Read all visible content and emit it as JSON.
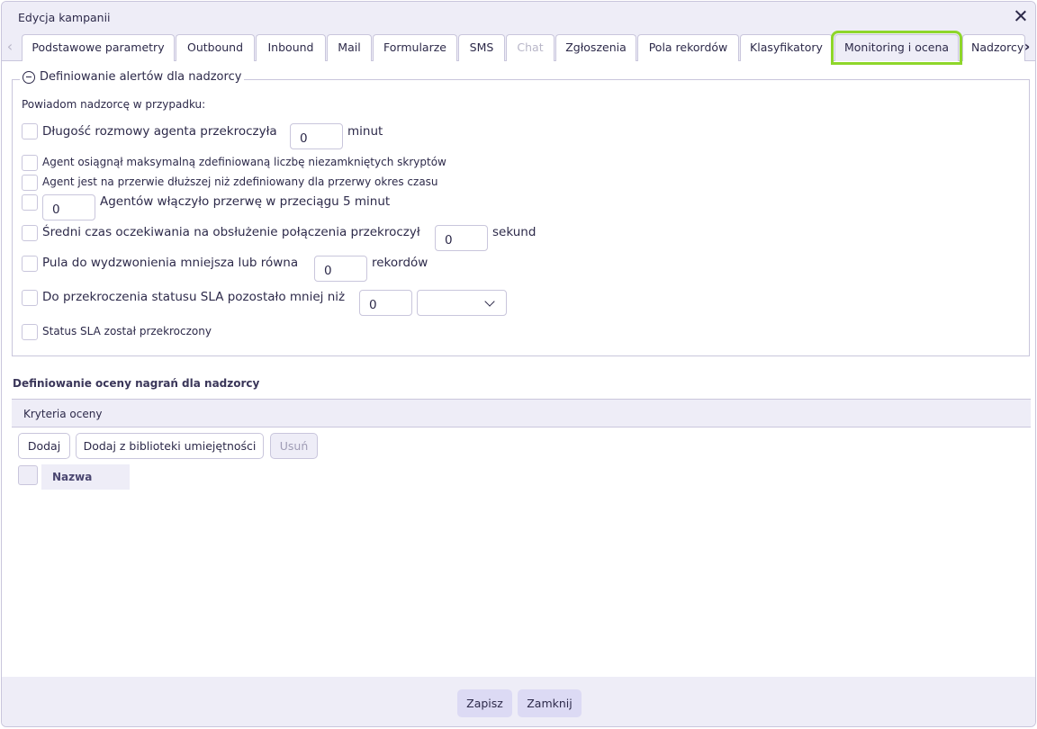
{
  "window": {
    "title": "Edycja kampanii"
  },
  "tabs": [
    {
      "label": "Podstawowe parametry"
    },
    {
      "label": "Outbound"
    },
    {
      "label": "Inbound"
    },
    {
      "label": "Mail"
    },
    {
      "label": "Formularze"
    },
    {
      "label": "SMS"
    },
    {
      "label": "Chat"
    },
    {
      "label": "Zgłoszenia"
    },
    {
      "label": "Pola rekordów"
    },
    {
      "label": "Klasyfikatory"
    },
    {
      "label": "Monitoring i ocena"
    },
    {
      "label": "Nadzorcy"
    }
  ],
  "active_tab": "Monitoring i ocena",
  "highlight_color": "#8ed62a",
  "alerts": {
    "legend": "Definiowanie alertów dla nadzorcy",
    "intro": "Powiadom nadzorcę w przypadku:",
    "call_length": {
      "label": "Długość rozmowy agenta przekroczyła",
      "value": "0",
      "unit": "minut"
    },
    "unclosed_scripts": {
      "label": "Agent osiągnął maksymalną zdefiniowaną liczbę niezamkniętych skryptów"
    },
    "long_break": {
      "label": "Agent jest na przerwie dłuższej niż zdefiniowany dla przerwy okres czasu"
    },
    "agents_break": {
      "value": "0",
      "label": "Agentów włączyło przerwę w przeciągu 5 minut"
    },
    "avg_wait": {
      "label": "Średni czas oczekiwania na obsłużenie połączenia przekroczył",
      "value": "0",
      "unit": "sekund"
    },
    "pool": {
      "label": "Pula do wydzwonienia mniejsza lub równa",
      "value": "0",
      "unit": "rekordów"
    },
    "sla_remaining": {
      "label": "Do przekroczenia statusu SLA pozostało mniej niż",
      "value": "0",
      "unit_selected": ""
    },
    "sla_exceeded": {
      "label": "Status SLA został przekroczony"
    }
  },
  "evaluation": {
    "title": "Definiowanie oceny nagrań dla nadzorcy",
    "grid_header": "Kryteria oceny",
    "buttons": {
      "add": "Dodaj",
      "add_from_library": "Dodaj z biblioteki umiejętności",
      "remove": "Usuń"
    },
    "columns": {
      "name": "Nazwa"
    }
  },
  "footer": {
    "save": "Zapisz",
    "close": "Zamknij"
  }
}
